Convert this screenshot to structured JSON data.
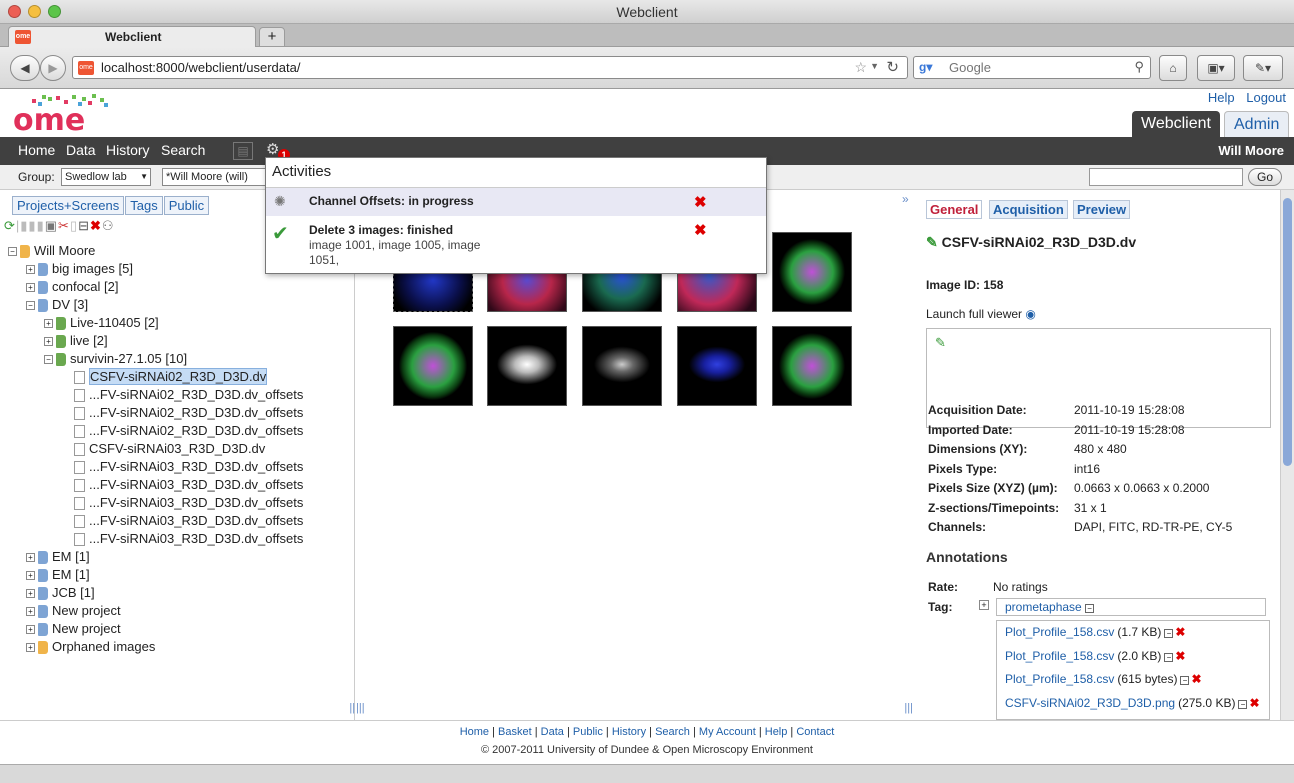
{
  "browser": {
    "window_title": "Webclient",
    "tab_title": "Webclient",
    "url": "localhost:8000/webclient/userdata/",
    "search_placeholder": "Google",
    "new_tab": "+"
  },
  "header": {
    "logo_text": "omé",
    "help": "Help",
    "logout": "Logout",
    "app_tabs": [
      "Webclient",
      "Admin"
    ]
  },
  "nav": {
    "items": [
      "Home",
      "Data",
      "History",
      "Search"
    ],
    "user": "Will Moore",
    "activities_count": "1"
  },
  "subbar": {
    "group_label": "Group:",
    "group_value": "Swedlow lab",
    "user_value": "*Will Moore (will)",
    "go": "Go"
  },
  "activities": {
    "title": "Activities",
    "items": [
      {
        "title": "Channel Offsets: in progress",
        "detail": ""
      },
      {
        "title": "Delete 3 images: finished",
        "detail": "image 1001, image 1005, image",
        "detail2": "1051,"
      }
    ]
  },
  "left": {
    "tabs": [
      "Projects+Screens",
      "Tags",
      "Public"
    ],
    "tree": [
      {
        "label": "Will Moore",
        "level": 0,
        "type": "user"
      },
      {
        "label": "big images [5]",
        "level": 1,
        "type": "project"
      },
      {
        "label": "confocal [2]",
        "level": 1,
        "type": "project"
      },
      {
        "label": "DV [3]",
        "level": 1,
        "type": "project"
      },
      {
        "label": "Live-110405 [2]",
        "level": 2,
        "type": "dataset"
      },
      {
        "label": "live [2]",
        "level": 2,
        "type": "dataset"
      },
      {
        "label": "survivin-27.1.05 [10]",
        "level": 2,
        "type": "dataset"
      },
      {
        "label": "CSFV-siRNAi02_R3D_D3D.dv",
        "level": 3,
        "type": "image",
        "selected": true
      },
      {
        "label": "...FV-siRNAi02_R3D_D3D.dv_offsets",
        "level": 3,
        "type": "image"
      },
      {
        "label": "...FV-siRNAi02_R3D_D3D.dv_offsets",
        "level": 3,
        "type": "image"
      },
      {
        "label": "...FV-siRNAi02_R3D_D3D.dv_offsets",
        "level": 3,
        "type": "image"
      },
      {
        "label": "CSFV-siRNAi03_R3D_D3D.dv",
        "level": 3,
        "type": "image"
      },
      {
        "label": "...FV-siRNAi03_R3D_D3D.dv_offsets",
        "level": 3,
        "type": "image"
      },
      {
        "label": "...FV-siRNAi03_R3D_D3D.dv_offsets",
        "level": 3,
        "type": "image"
      },
      {
        "label": "...FV-siRNAi03_R3D_D3D.dv_offsets",
        "level": 3,
        "type": "image"
      },
      {
        "label": "...FV-siRNAi03_R3D_D3D.dv_offsets",
        "level": 3,
        "type": "image"
      },
      {
        "label": "...FV-siRNAi03_R3D_D3D.dv_offsets",
        "level": 3,
        "type": "image"
      },
      {
        "label": "EM [1]",
        "level": 1,
        "type": "project"
      },
      {
        "label": "EM [1]",
        "level": 1,
        "type": "project"
      },
      {
        "label": "JCB [1]",
        "level": 1,
        "type": "project"
      },
      {
        "label": "New project",
        "level": 1,
        "type": "project"
      },
      {
        "label": "New project",
        "level": 1,
        "type": "project"
      },
      {
        "label": "Orphaned images",
        "level": 1,
        "type": "orphan"
      }
    ]
  },
  "right": {
    "tabs": [
      "General",
      "Acquisition",
      "Preview"
    ],
    "image_name": "CSFV-siRNAi02_R3D_D3D.dv",
    "image_id": "Image ID: 158",
    "launch": "Launch full viewer",
    "metadata": [
      {
        "k": "Acquisition Date:",
        "v": "2011-10-19 15:28:08"
      },
      {
        "k": "Imported Date:",
        "v": "2011-10-19 15:28:08"
      },
      {
        "k": "Dimensions (XY):",
        "v": "480 x 480"
      },
      {
        "k": "Pixels Type:",
        "v": "int16"
      },
      {
        "k": "Pixels Size (XYZ) (µm):",
        "v": "0.0663 x 0.0663 x 0.2000"
      },
      {
        "k": "Z-sections/Timepoints:",
        "v": "31 x 1"
      },
      {
        "k": "Channels:",
        "v": "DAPI, FITC, RD-TR-PE, CY-5"
      }
    ],
    "annotations_title": "Annotations",
    "rate_label": "Rate:",
    "rate_value": "No ratings",
    "tag_label": "Tag:",
    "tag_value": "prometaphase",
    "files": [
      {
        "name": "Plot_Profile_158.csv",
        "size": "(1.7 KB)"
      },
      {
        "name": "Plot_Profile_158.csv",
        "size": "(2.0 KB)"
      },
      {
        "name": "Plot_Profile_158.csv",
        "size": "(615 bytes)"
      },
      {
        "name": "CSFV-siRNAi02_R3D_D3D.png",
        "size": "(275.0 KB)"
      }
    ]
  },
  "footer": {
    "links": [
      "Home",
      "Basket",
      "Data",
      "Public",
      "History",
      "Search",
      "My Account",
      "Help",
      "Contact"
    ],
    "copyright": "© 2007-2011 University of Dundee & Open Microscopy Environment"
  },
  "colors": {
    "nav_bg": "#404040",
    "link": "#1f5fa8",
    "accent_red": "#d00000"
  }
}
